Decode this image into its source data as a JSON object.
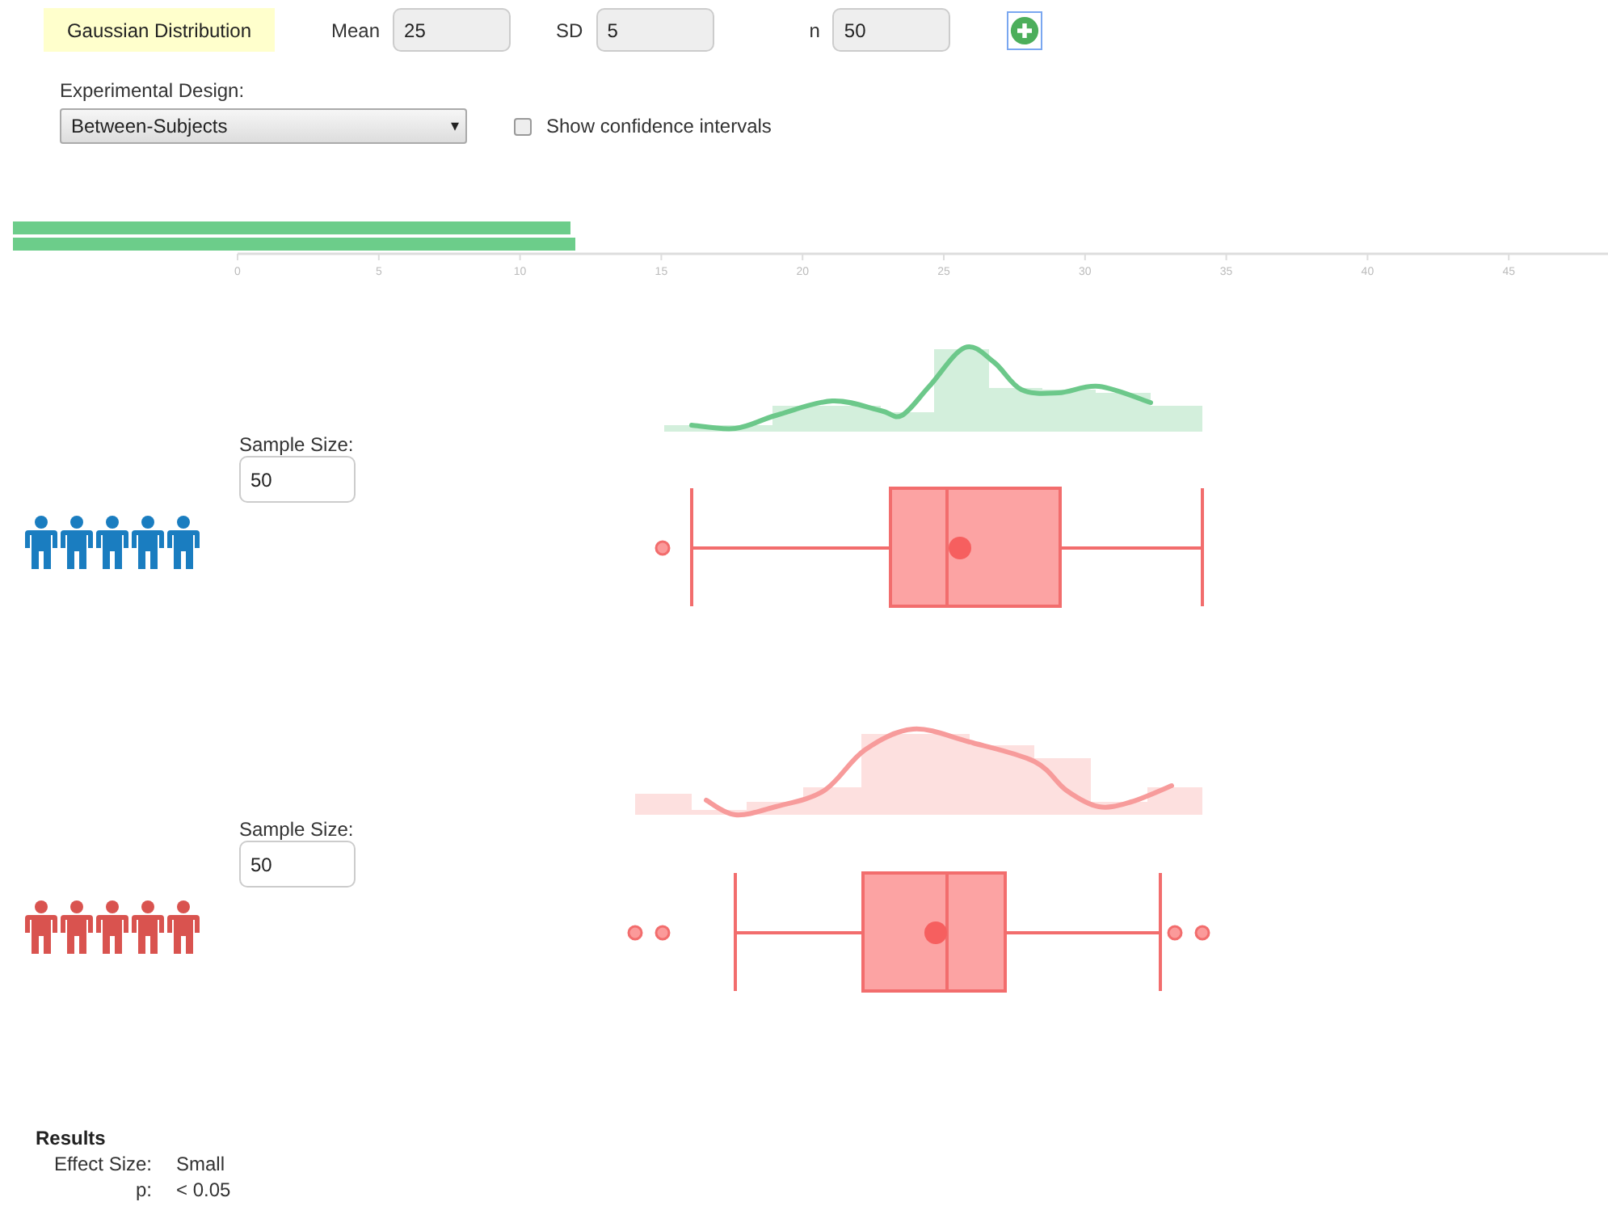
{
  "distribution": {
    "label": "Gaussian Distribution",
    "fields": [
      {
        "label": "Mean",
        "value": "25"
      },
      {
        "label": "SD",
        "value": "5"
      },
      {
        "label": "n",
        "value": "50"
      }
    ]
  },
  "design": {
    "label": "Experimental Design:",
    "value": "Between-Subjects",
    "caret": "▾",
    "confidence_intervals": {
      "label": "Show confidence intervals",
      "checked": false
    }
  },
  "axis": {
    "ticks": [
      "0",
      "5",
      "10",
      "15",
      "20",
      "25",
      "30",
      "35",
      "40",
      "45"
    ]
  },
  "groups": [
    {
      "color": "#1a7dc0",
      "label": "Sample Size:",
      "value": "50"
    },
    {
      "color": "#d9534f",
      "label": "Sample Size:",
      "value": "50"
    }
  ],
  "results": {
    "title": "Results",
    "rows": [
      {
        "label": "Effect Size:",
        "value": "Small"
      },
      {
        "label": "p:",
        "value": "< 0.05"
      }
    ]
  }
}
